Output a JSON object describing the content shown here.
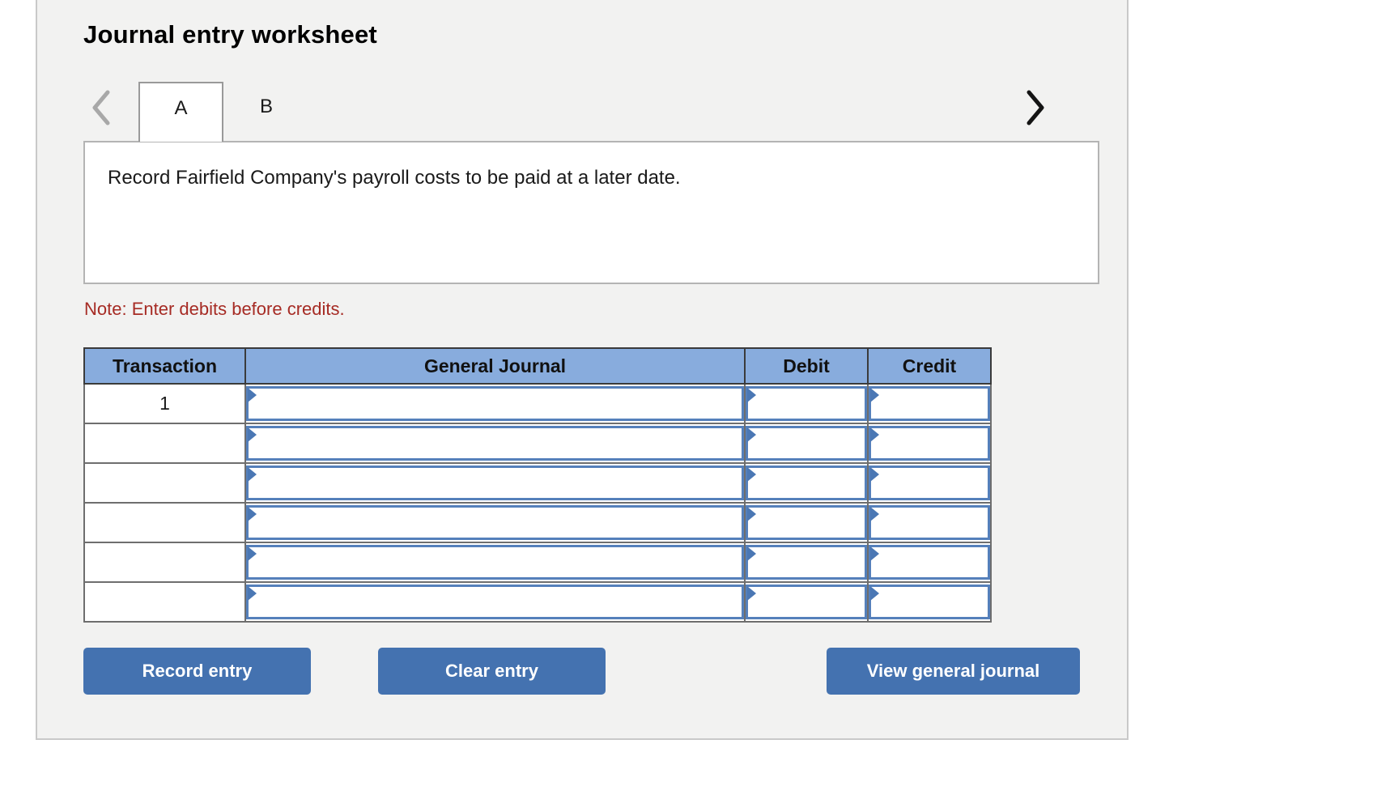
{
  "panel": {
    "title": "Journal entry worksheet"
  },
  "tabs": {
    "prev_icon": "chevron-left-icon",
    "next_icon": "chevron-right-icon",
    "items": [
      {
        "label": "A",
        "active": true
      },
      {
        "label": "B",
        "active": false
      }
    ]
  },
  "description": {
    "text": "Record Fairfield Company's payroll costs to be paid at a later date."
  },
  "note": {
    "text": "Note: Enter debits before credits."
  },
  "table": {
    "headers": [
      "Transaction",
      "General Journal",
      "Debit",
      "Credit"
    ],
    "rows": [
      {
        "transaction": "1",
        "general_journal": "",
        "debit": "",
        "credit": ""
      },
      {
        "transaction": "",
        "general_journal": "",
        "debit": "",
        "credit": ""
      },
      {
        "transaction": "",
        "general_journal": "",
        "debit": "",
        "credit": ""
      },
      {
        "transaction": "",
        "general_journal": "",
        "debit": "",
        "credit": ""
      },
      {
        "transaction": "",
        "general_journal": "",
        "debit": "",
        "credit": ""
      },
      {
        "transaction": "",
        "general_journal": "",
        "debit": "",
        "credit": ""
      }
    ]
  },
  "buttons": {
    "record": "Record entry",
    "clear": "Clear entry",
    "view": "View general journal"
  },
  "colors": {
    "header_blue": "#88acdd",
    "button_blue": "#4472b0",
    "note_red": "#a62b24",
    "panel_bg": "#f2f2f1",
    "input_border_blue": "#5580bb"
  }
}
